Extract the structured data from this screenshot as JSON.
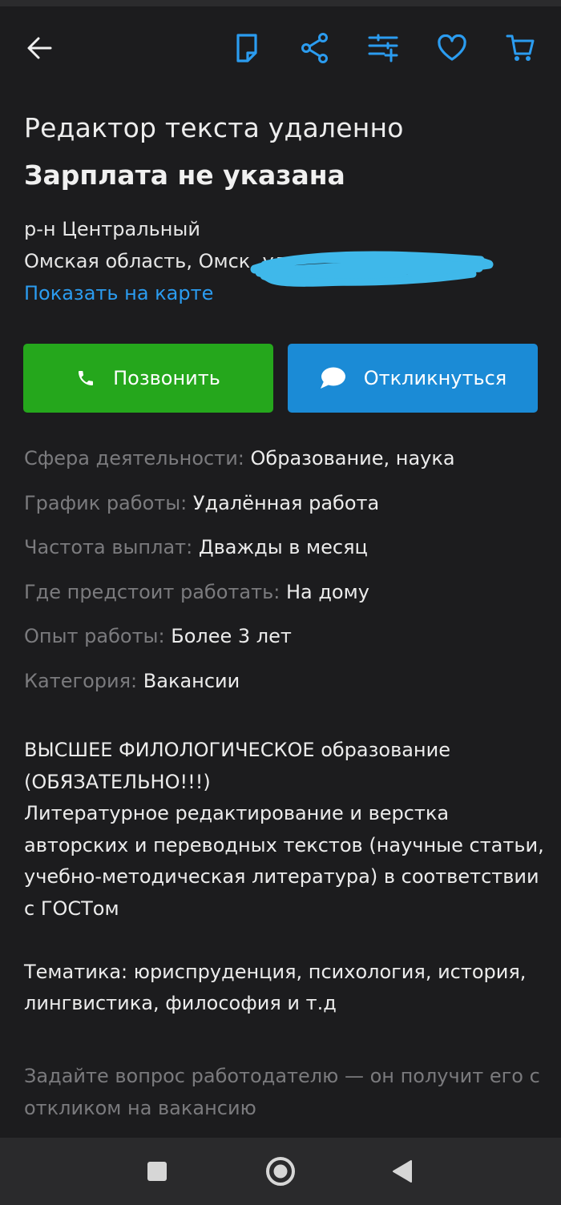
{
  "colors": {
    "background": "#1c1c1e",
    "accent_blue": "#2b9cf0",
    "call_green": "#25a71c",
    "reply_blue": "#1b8bd6",
    "muted_text": "#7b7b7e"
  },
  "toolbar": {
    "icons": [
      "back-arrow-icon",
      "note-icon",
      "share-icon",
      "filter-add-icon",
      "heart-icon",
      "cart-icon"
    ]
  },
  "vacancy": {
    "title": "Редактор текста удаленно",
    "salary": "Зарплата не указана",
    "district": "р-н Центральный",
    "address": "Омская область, Омск, ул.",
    "map_link": "Показать на карте"
  },
  "actions": {
    "call_label": "Позвонить",
    "reply_label": "Откликнуться"
  },
  "properties": [
    {
      "label": "Сфера деятельности:",
      "value": "Образование, наука"
    },
    {
      "label": "График работы:",
      "value": "Удалённая работа"
    },
    {
      "label": "Частота выплат:",
      "value": "Дважды в месяц"
    },
    {
      "label": "Где предстоит работать:",
      "value": "На дому"
    },
    {
      "label": "Опыт работы:",
      "value": "Более 3 лет"
    },
    {
      "label": "Категория:",
      "value": "Вакансии"
    }
  ],
  "description": {
    "line1": "ВЫСШЕЕ ФИЛОЛОГИЧЕСКОЕ образование",
    "line2": "(ОБЯЗАТЕЛЬНО!!!)",
    "paragraph1": "Литературное редактирование и верстка авторских и переводных текстов (научные статьи, учебно-методическая литература) в соответствии с ГОСТом",
    "paragraph2": "Тематика: юриспруденция, психология, история, лингвистика, философия и т.д"
  },
  "hint": "Задайте вопрос работодателю — он получит его с откликом на вакансию",
  "system_nav": {
    "icons": [
      "recents-square-icon",
      "home-circle-icon",
      "back-triangle-icon"
    ]
  }
}
